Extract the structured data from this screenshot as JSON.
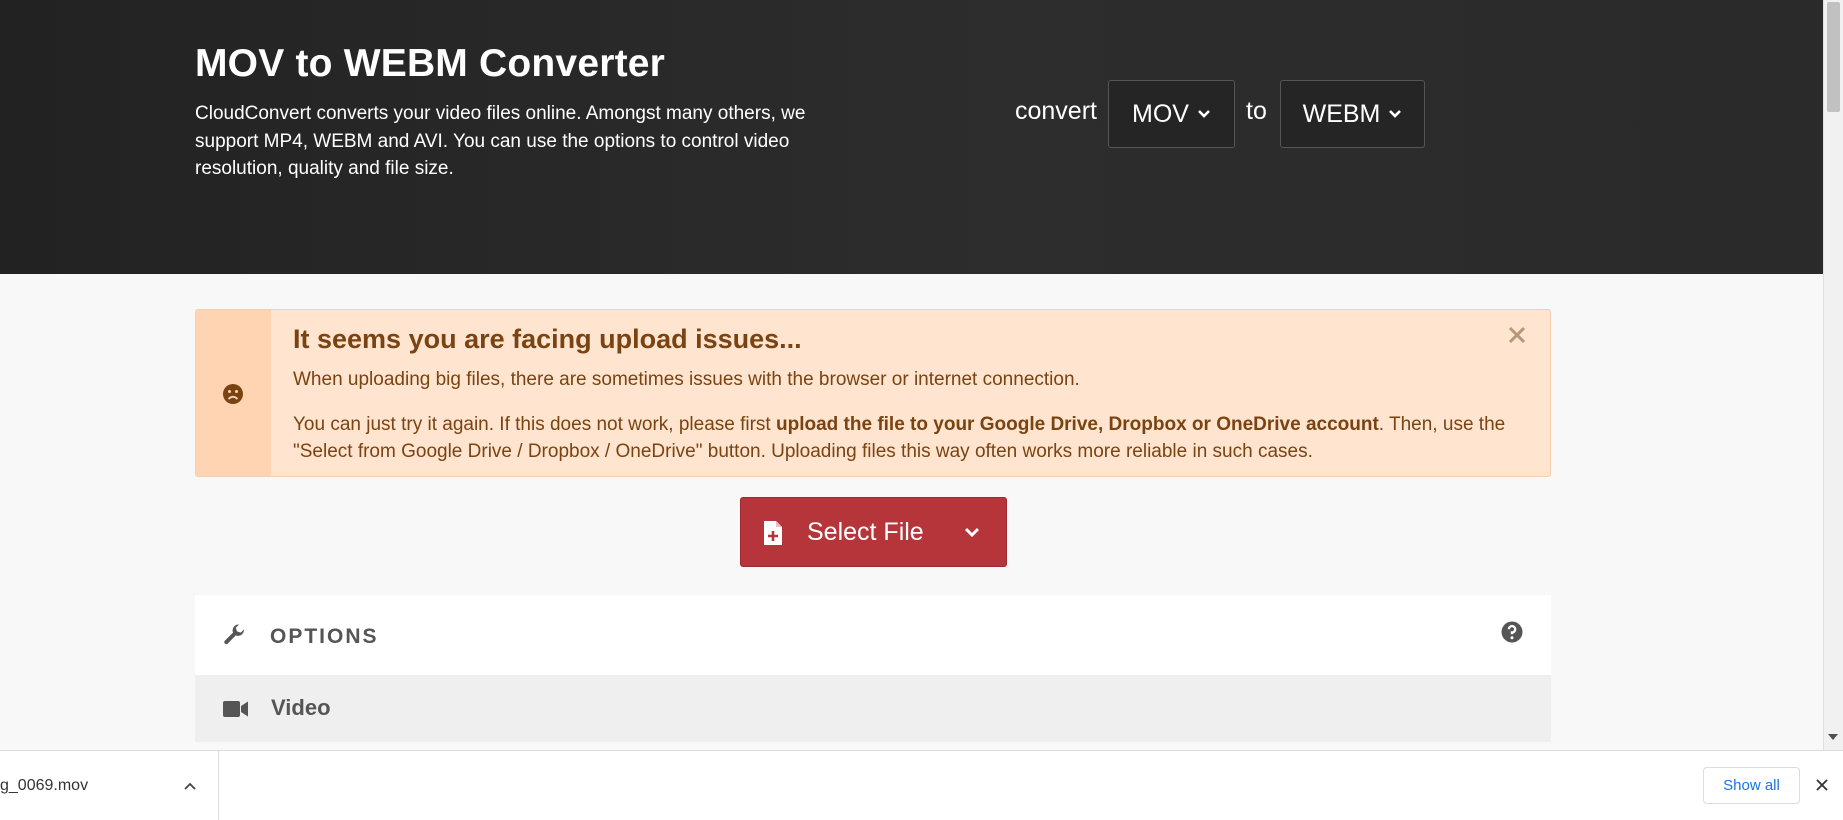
{
  "hero": {
    "title": "MOV to WEBM Converter",
    "description": "CloudConvert converts your video files online. Amongst many others, we support MP4, WEBM and AVI. You can use the options to control video resolution, quality and file size.",
    "convert_label": "convert",
    "to_label": "to",
    "from_format": "MOV",
    "to_format": "WEBM"
  },
  "alert": {
    "title": "It seems you are facing upload issues...",
    "paragraph1": "When uploading big files, there are sometimes issues with the browser or internet connection.",
    "paragraph2_before": "You can just try it again. If this does not work, please first ",
    "paragraph2_bold": "upload the file to your Google Drive, Dropbox or OneDrive account",
    "paragraph2_after": ". Then, use the \"Select from Google Drive / Dropbox / OneDrive\" button. Uploading files this way often works more reliable in such cases."
  },
  "select_file": {
    "label": "Select File"
  },
  "options": {
    "label": "OPTIONS"
  },
  "video_section": {
    "label": "Video"
  },
  "download_bar": {
    "filename": "g_0069.mov",
    "show_all_label": "Show all"
  },
  "colors": {
    "hero_bg": "#2a2a2a",
    "alert_bg": "#ffe4cf",
    "alert_text": "#7a4312",
    "primary_button": "#b5353a",
    "link_blue": "#1a73e8"
  }
}
